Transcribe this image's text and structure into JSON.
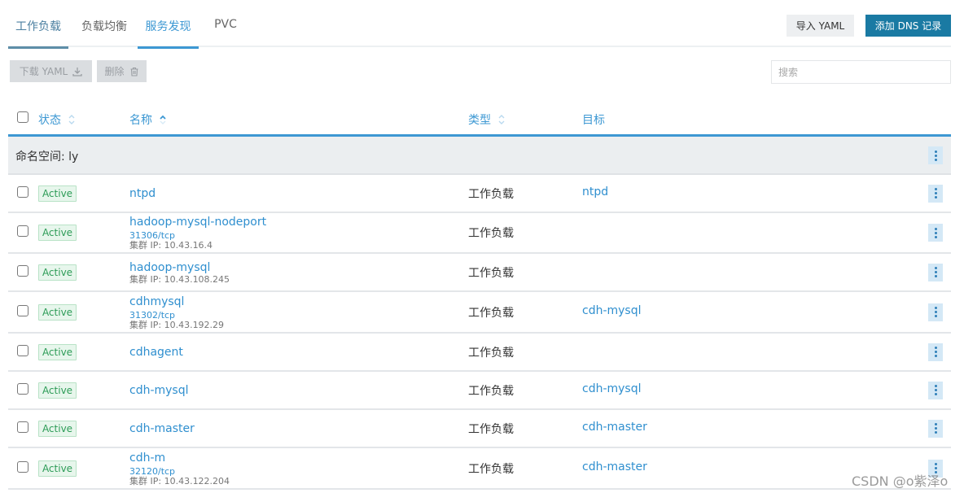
{
  "tabs": [
    {
      "label": "工作负载",
      "state": "visited"
    },
    {
      "label": "负载均衡",
      "state": "normal"
    },
    {
      "label": "服务发现",
      "state": "active"
    },
    {
      "label": "PVC",
      "state": "normal"
    }
  ],
  "header_buttons": {
    "import_yaml": "导入 YAML",
    "add_dns": "添加 DNS 记录"
  },
  "toolbar": {
    "download_yaml": "下载 YAML",
    "delete": "删除",
    "search_placeholder": "搜索"
  },
  "table": {
    "columns": {
      "status": "状态",
      "name": "名称",
      "type": "类型",
      "target": "目标"
    },
    "group_label": "命名空间: ly",
    "rows": [
      {
        "status": "Active",
        "name": "ntpd",
        "port": "",
        "ip": "",
        "type": "工作负载",
        "target": "ntpd"
      },
      {
        "status": "Active",
        "name": "hadoop-mysql-nodeport",
        "port": "31306/tcp",
        "ip": "集群 IP: 10.43.16.4",
        "type": "工作负载",
        "target": ""
      },
      {
        "status": "Active",
        "name": "hadoop-mysql",
        "port": "",
        "ip": "集群 IP: 10.43.108.245",
        "type": "工作负载",
        "target": ""
      },
      {
        "status": "Active",
        "name": "cdhmysql",
        "port": "31302/tcp",
        "ip": "集群 IP: 10.43.192.29",
        "type": "工作负载",
        "target": "cdh-mysql"
      },
      {
        "status": "Active",
        "name": "cdhagent",
        "port": "",
        "ip": "",
        "type": "工作负载",
        "target": ""
      },
      {
        "status": "Active",
        "name": "cdh-mysql",
        "port": "",
        "ip": "",
        "type": "工作负载",
        "target": "cdh-mysql"
      },
      {
        "status": "Active",
        "name": "cdh-master",
        "port": "",
        "ip": "",
        "type": "工作负载",
        "target": "cdh-master"
      },
      {
        "status": "Active",
        "name": "cdh-m",
        "port": "32120/tcp",
        "ip": "集群 IP: 10.43.122.204",
        "type": "工作负载",
        "target": "cdh-master"
      }
    ]
  },
  "watermark": "CSDN @o紫泽o",
  "colors": {
    "accent": "#3d98d3",
    "primary_button": "#1a7aa3",
    "active_badge_text": "#2d9c57",
    "active_badge_bg": "#e7f6ec",
    "link": "#2f8fcf"
  }
}
